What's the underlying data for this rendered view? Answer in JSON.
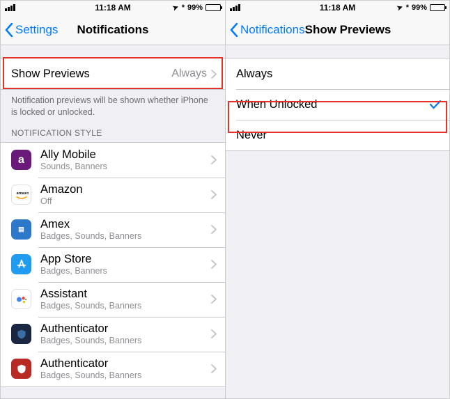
{
  "status": {
    "time": "11:18 AM",
    "battery_pct": "99%",
    "location_glyph": "➤",
    "bluetooth_glyph": "*"
  },
  "left": {
    "back_label": "Settings",
    "title": "Notifications",
    "show_previews": {
      "label": "Show Previews",
      "value": "Always"
    },
    "footer": "Notification previews will be shown whether iPhone is locked or unlocked.",
    "style_header": "NOTIFICATION STYLE",
    "apps": [
      {
        "name": "Ally Mobile",
        "detail": "Sounds, Banners",
        "icon": "ally"
      },
      {
        "name": "Amazon",
        "detail": "Off",
        "icon": "amazon"
      },
      {
        "name": "Amex",
        "detail": "Badges, Sounds, Banners",
        "icon": "amex"
      },
      {
        "name": "App Store",
        "detail": "Badges, Banners",
        "icon": "appstore"
      },
      {
        "name": "Assistant",
        "detail": "Badges, Sounds, Banners",
        "icon": "assistant"
      },
      {
        "name": "Authenticator",
        "detail": "Badges, Sounds, Banners",
        "icon": "auth1"
      },
      {
        "name": "Authenticator",
        "detail": "Badges, Sounds, Banners",
        "icon": "auth2"
      }
    ]
  },
  "right": {
    "back_label": "Notifications",
    "title": "Show Previews",
    "options": [
      {
        "label": "Always",
        "selected": false
      },
      {
        "label": "When Unlocked",
        "selected": true
      },
      {
        "label": "Never",
        "selected": false
      }
    ]
  }
}
